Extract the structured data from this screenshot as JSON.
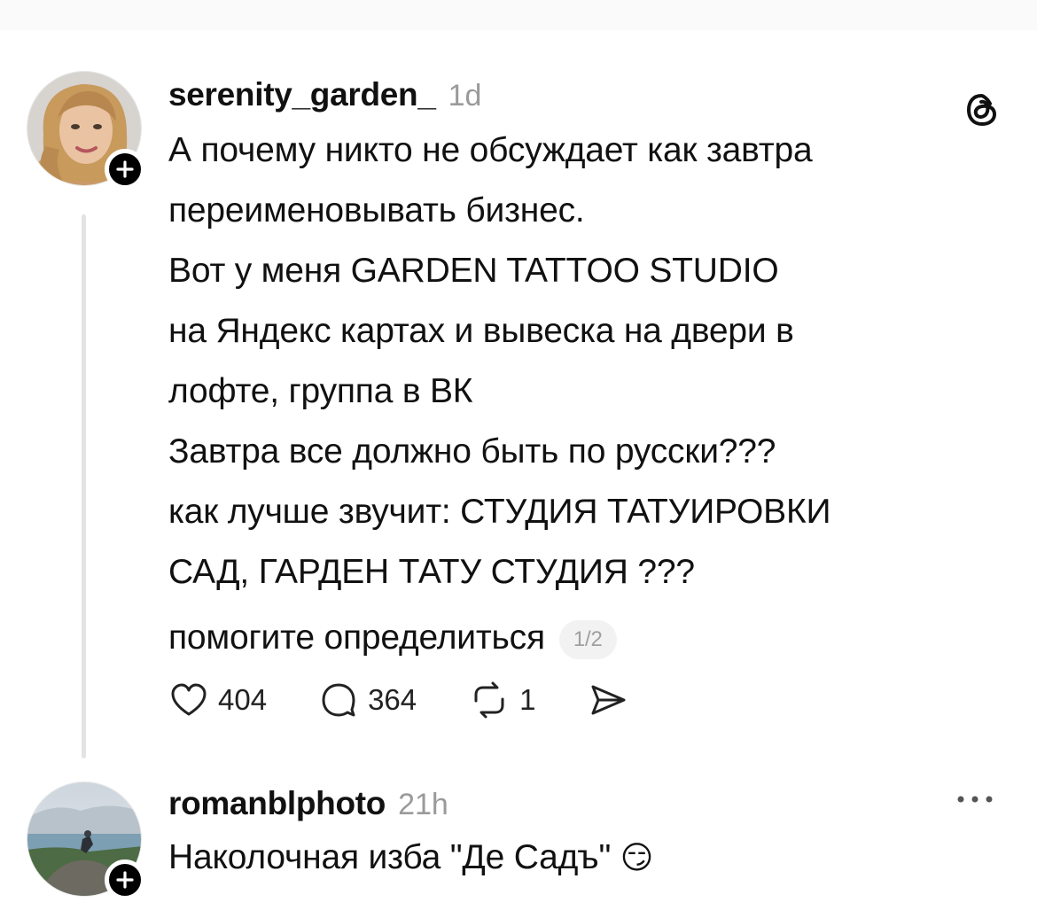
{
  "post": {
    "username": "serenity_garden_",
    "time": "1d",
    "lines": [
      "А почему никто не обсуждает как завтра",
      "переименовывать бизнес.",
      "Вот у меня GARDEN TATTOO STUDIO",
      "на Яндекс картах и вывеска на двери в",
      "лофте, группа в ВК",
      "Завтра все должно быть по русски???",
      "как лучше звучит: СТУДИЯ ТАТУИРОВКИ",
      "САД, ГАРДЕН ТАТУ СТУДИЯ ???",
      "помогите определиться"
    ],
    "page_indicator": "1/2",
    "likes": "404",
    "comments": "364",
    "reposts": "1",
    "icons": [
      "threads-logo-icon",
      "plus-icon",
      "heart-icon",
      "comment-icon",
      "repost-icon",
      "share-icon"
    ]
  },
  "reply": {
    "username": "romanblphoto",
    "time": "21h",
    "text": "Наколочная изба \"Де Садъ\"",
    "emoji": "😏",
    "icons": [
      "plus-icon",
      "more-icon"
    ]
  },
  "colors": {
    "text": "#111111",
    "muted": "#9a9a9a",
    "thread_line": "#e3e3e3",
    "pill_bg": "#f2f2f2"
  }
}
